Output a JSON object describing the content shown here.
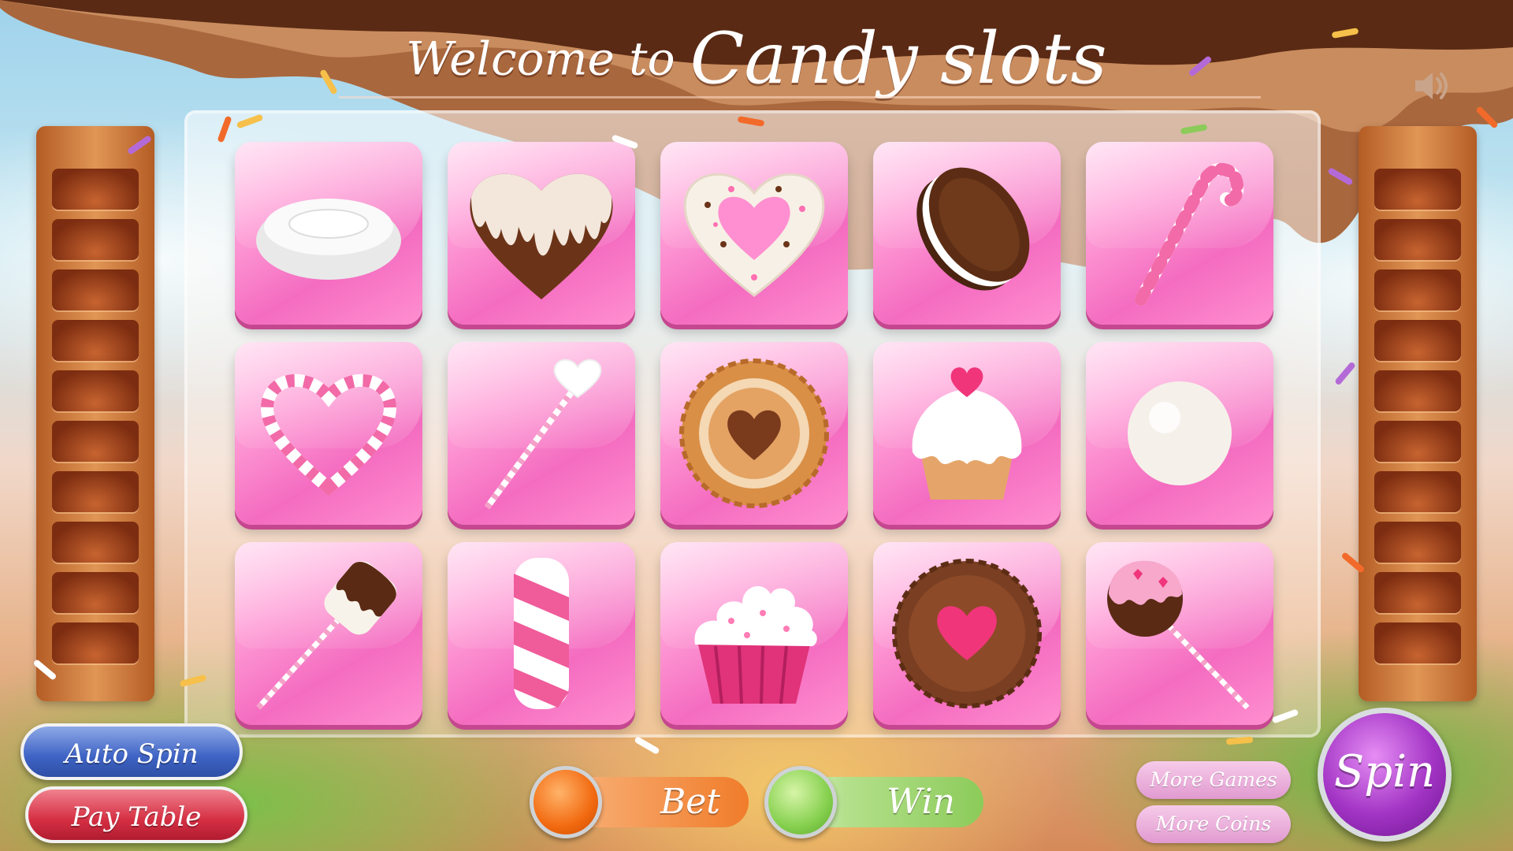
{
  "header": {
    "title_prefix": "Welcome to",
    "title_main": "Candy slots",
    "sound_icon": "speaker-icon"
  },
  "reels": [
    [
      "white-candy-drop-icon",
      "chocolate-dipped-heart-icon",
      "sprinkle-heart-cookie-icon",
      "sandwich-cookie-icon",
      "candy-cane-icon"
    ],
    [
      "striped-heart-candy-icon",
      "heart-lollipop-stick-icon",
      "heart-jam-cookie-icon",
      "heart-cupcake-icon",
      "white-gumball-icon"
    ],
    [
      "chocolate-marshmallow-stick-icon",
      "twisted-marshmallow-icon",
      "frosted-cupcake-icon",
      "chocolate-heart-cookie-icon",
      "cake-pop-icon"
    ]
  ],
  "controls": {
    "auto_spin_label": "Auto Spin",
    "pay_table_label": "Pay Table",
    "bet_label": "Bet",
    "win_label": "Win",
    "more_games_label": "More Games",
    "more_coins_label": "More Coins",
    "spin_label": "Spin"
  },
  "colors": {
    "tile_pink": "#f46cc0",
    "auto_spin_blue": "#3e63c4",
    "pay_table_red": "#d52f43",
    "bet_orange": "#f07c2a",
    "win_green": "#8ccb5a",
    "spin_purple": "#a234c4",
    "chocolate": "#6b3418"
  }
}
